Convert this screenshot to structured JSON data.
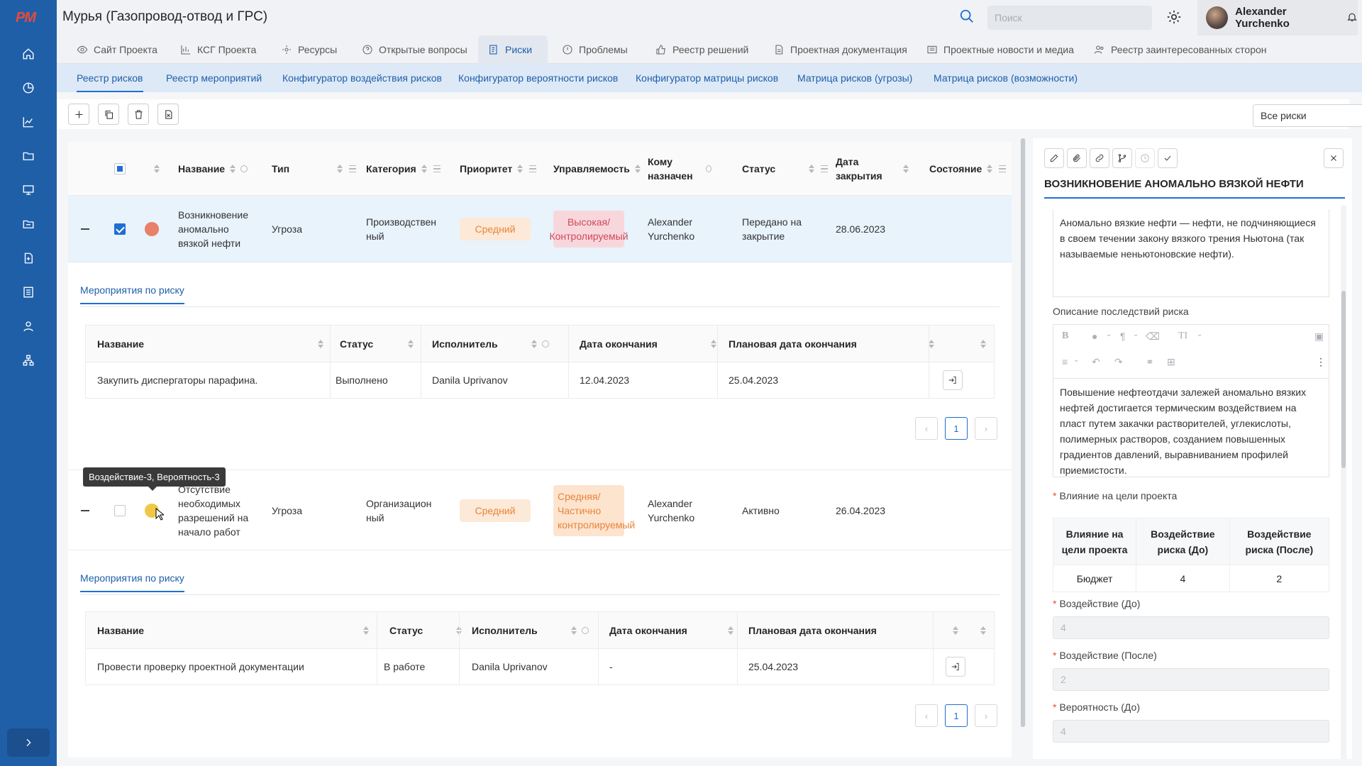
{
  "app": {
    "logo": "PM",
    "title": "Мурья (Газопровод-отвод и ГРС)"
  },
  "header": {
    "search_placeholder": "Поиск",
    "user_name": "Alexander Yurchenko"
  },
  "tabs": [
    {
      "label": "Сайт Проекта",
      "icon": "eye-icon"
    },
    {
      "label": "КСГ Проекта",
      "icon": "chart-icon"
    },
    {
      "label": "Ресурсы",
      "icon": "gear-icon"
    },
    {
      "label": "Открытые вопросы",
      "icon": "question-icon"
    },
    {
      "label": "Риски",
      "icon": "risk-icon"
    },
    {
      "label": "Проблемы",
      "icon": "alert-icon"
    },
    {
      "label": "Реестр решений",
      "icon": "thumbs-up-icon"
    },
    {
      "label": "Проектная документация",
      "icon": "document-icon"
    },
    {
      "label": "Проектные новости и медиа",
      "icon": "news-icon"
    },
    {
      "label": "Реестр заинтересованных сторон",
      "icon": "users-icon"
    }
  ],
  "subtabs": [
    "Реестр рисков",
    "Реестр мероприятий",
    "Конфигуратор воздействия рисков",
    "Конфигуратор вероятности рисков",
    "Конфигуратор матрицы рисков",
    "Матрица рисков (угрозы)",
    "Матрица рисков (возможности)"
  ],
  "filter": {
    "selected": "Все риски"
  },
  "table": {
    "columns": [
      "Название",
      "Тип",
      "Категория",
      "Приоритет",
      "Управляемость",
      "Кому назначен",
      "Статус",
      "Дата закрытия",
      "Состояние"
    ],
    "rows": [
      {
        "name": "Возникновение аномально вязкой нефти",
        "type": "Угроза",
        "category": "Производственный",
        "priority": "Средний",
        "control": "Высокая/ Контролируемый",
        "assignee": "Alexander Yurchenko",
        "status": "Передано на закрытие",
        "close_date": "28.06.2023",
        "state": "",
        "dot_color": "#e8806a"
      },
      {
        "name": "Отсутствие необходимых разрешений на начало работ",
        "type": "Угроза",
        "category": "Организационный",
        "priority": "Средний",
        "control": "Средняя/ Частично контролируемый",
        "assignee": "Alexander Yurchenko",
        "status": "Активно",
        "close_date": "26.04.2023",
        "state": "",
        "dot_color": "#f0c846"
      }
    ]
  },
  "measures_title": "Мероприятия по риску",
  "measures_columns": [
    "Название",
    "Статус",
    "Исполнитель",
    "Дата окончания",
    "Плановая дата окончания"
  ],
  "measures": [
    [
      {
        "name": "Закупить диспергаторы парафина.",
        "status": "Выполнено",
        "executor": "Danila Uprivanov",
        "end": "12.04.2023",
        "plan_end": "25.04.2023"
      }
    ],
    [
      {
        "name": "Провести проверку проектной документации",
        "status": "В работе",
        "executor": "Danila Uprivanov",
        "end": "-",
        "plan_end": "25.04.2023"
      }
    ]
  ],
  "pager": {
    "page": "1"
  },
  "tooltip": "Воздействие-3, Вероятность-3",
  "panel": {
    "title": "ВОЗНИКНОВЕНИЕ АНОМАЛЬНО ВЯЗКОЙ НЕФТИ",
    "description_text": "Аномально вязкие нефти — нефти, не подчиняющиеся в своем течении закону вязкого трения Ньютона (так называемые неньютоновские нефти).",
    "consequences_label": "Описание последствий риска",
    "consequences_text": "Повышение нефтеотдачи залежей аномально вязких нефтей достигается термическим воздействием на пласт путем закачки растворителей, углекислоты, полимерных растворов, созданием повышенных градиентов давлений, выравниванием профилей приемистости.",
    "impact_label": "Влияние на цели проекта",
    "impact_cols": [
      "Влияние на цели проекта",
      "Воздействие риска (До)",
      "Воздействие риска (После)"
    ],
    "impact_row": {
      "goal": "Бюджет",
      "before": "4",
      "after": "2"
    },
    "impact_before_label": "Воздействие (До)",
    "impact_before_value": "4",
    "impact_after_label": "Воздействие (После)",
    "impact_after_value": "2",
    "prob_before_label": "Вероятность (До)",
    "prob_before_value": "4",
    "required_mark": "*",
    "editor_toolbar": {
      "bold": "B",
      "paragraph": "¶",
      "text_size": "TI"
    }
  }
}
